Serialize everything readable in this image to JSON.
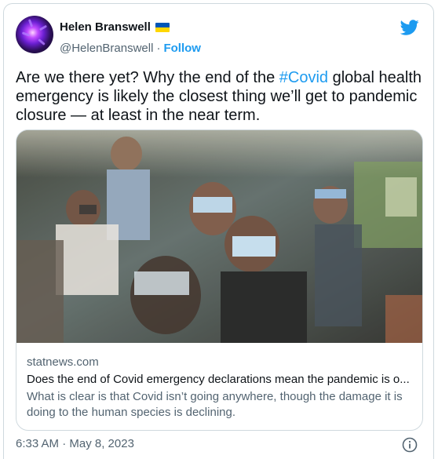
{
  "author": {
    "display_name": "Helen Branswell",
    "handle": "@HelenBranswell",
    "separator": "·",
    "follow_label": "Follow",
    "flag_icon": "ukraine-flag-icon",
    "flag_colors": [
      "#0057b7",
      "#ffd700"
    ]
  },
  "tweet": {
    "text_before": "Are we there yet? Why the end of the ",
    "hashtag": "#Covid",
    "text_after": " global health emergency is likely the closest thing we’ll get to pandemic closure — at least in the near term."
  },
  "link_card": {
    "domain": "statnews.com",
    "title": "Does the end of Covid emergency declarations mean the pandemic is o...",
    "description": "What is clear is that Covid isn’t going anywhere, though the damage it is doing to the human species is declining."
  },
  "footer": {
    "timestamp": "6:33 AM · May 8, 2023",
    "info_icon": "info-icon"
  },
  "colors": {
    "accent": "#1d9bf0",
    "text": "#0f1419",
    "secondary": "#536471",
    "border": "#cfd9de"
  }
}
